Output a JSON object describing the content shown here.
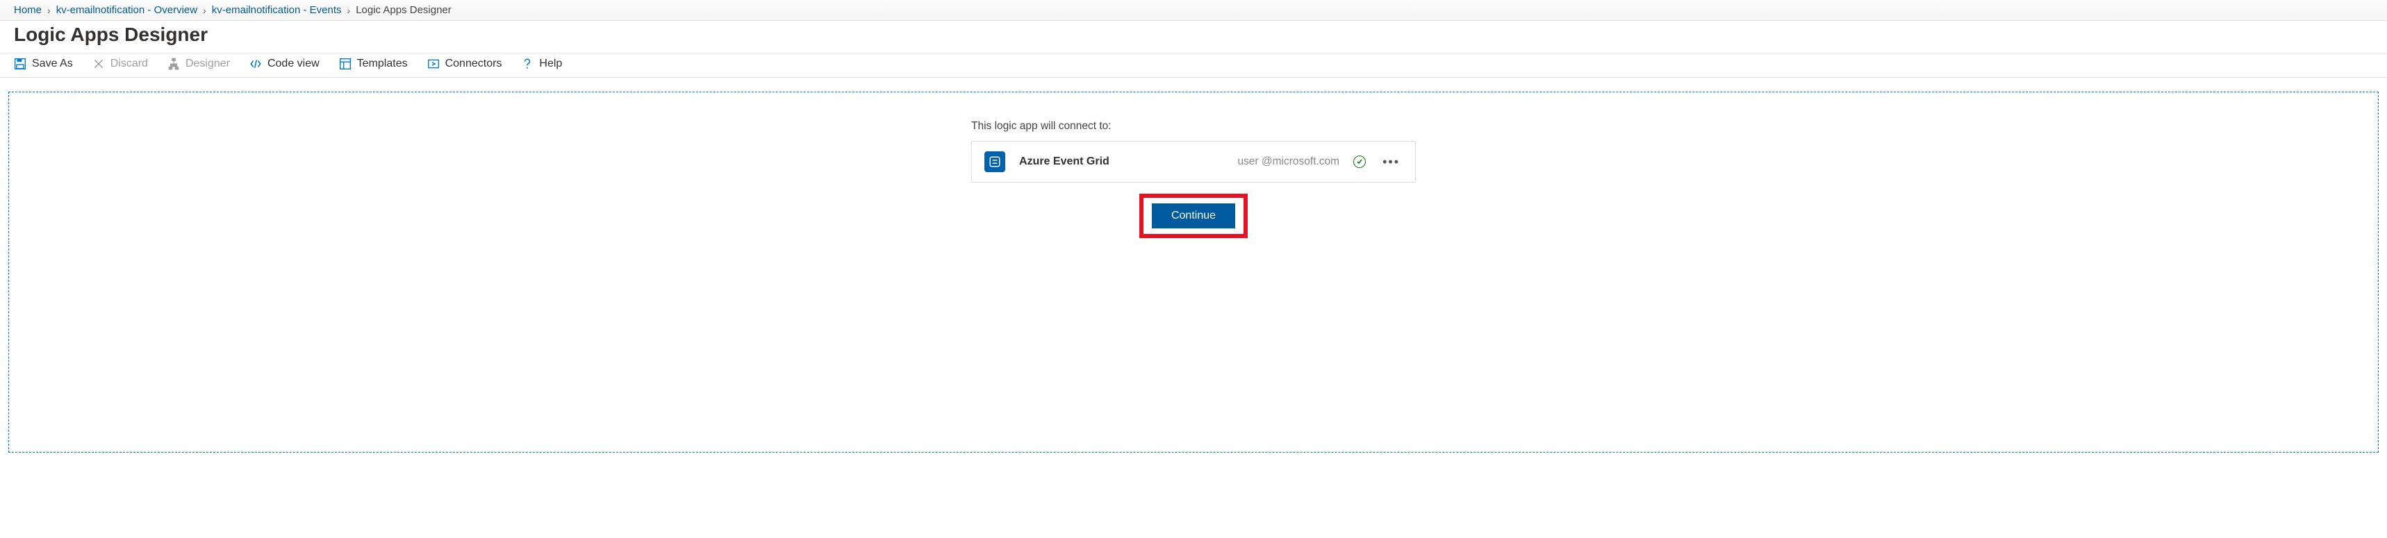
{
  "breadcrumb": {
    "items": [
      {
        "label": "Home"
      },
      {
        "label": "kv-emailnotification - Overview"
      },
      {
        "label": "kv-emailnotification - Events"
      }
    ],
    "current": "Logic Apps Designer"
  },
  "header": {
    "title": "Logic Apps Designer"
  },
  "toolbar": {
    "save_as": "Save As",
    "discard": "Discard",
    "designer": "Designer",
    "code_view": "Code view",
    "templates": "Templates",
    "connectors": "Connectors",
    "help": "Help"
  },
  "designer": {
    "connect_label": "This logic app will connect to:",
    "connection": {
      "icon_name": "azure-event-grid-icon",
      "service": "Azure Event Grid",
      "account": "user @microsoft.com",
      "status": "ok"
    },
    "continue_label": "Continue"
  },
  "colors": {
    "accent": "#0078d4",
    "primary": "#005a9e",
    "danger": "#e81123",
    "success": "#107c10"
  }
}
